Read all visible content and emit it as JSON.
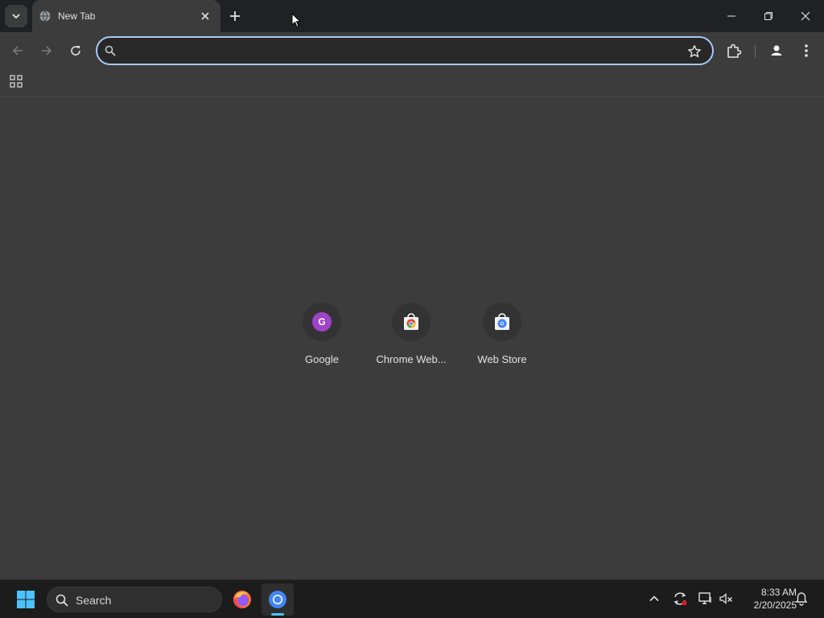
{
  "browser": {
    "tab": {
      "title": "New Tab",
      "favicon": "globe-icon"
    },
    "omnibox": {
      "value": "",
      "placeholder": ""
    }
  },
  "new_tab_page": {
    "shortcuts": [
      {
        "label": "Google",
        "icon": "google-g-icon",
        "icon_letter": "G",
        "icon_color": "#a142c8"
      },
      {
        "label": "Chrome Web...",
        "icon": "chrome-web-store-icon"
      },
      {
        "label": "Web Store",
        "icon": "web-store-icon"
      }
    ]
  },
  "taskbar": {
    "search_label": "Search",
    "clock": {
      "time": "8:33 AM",
      "date": "2/20/2025"
    },
    "apps": [
      {
        "name": "Firefox",
        "icon": "firefox-icon"
      },
      {
        "name": "Chrome",
        "icon": "chrome-icon",
        "active": true
      }
    ]
  },
  "colors": {
    "accent": "#a8c7fa",
    "taskbar_active_indicator": "#4cc2ff",
    "background": "#3c3c3c"
  }
}
